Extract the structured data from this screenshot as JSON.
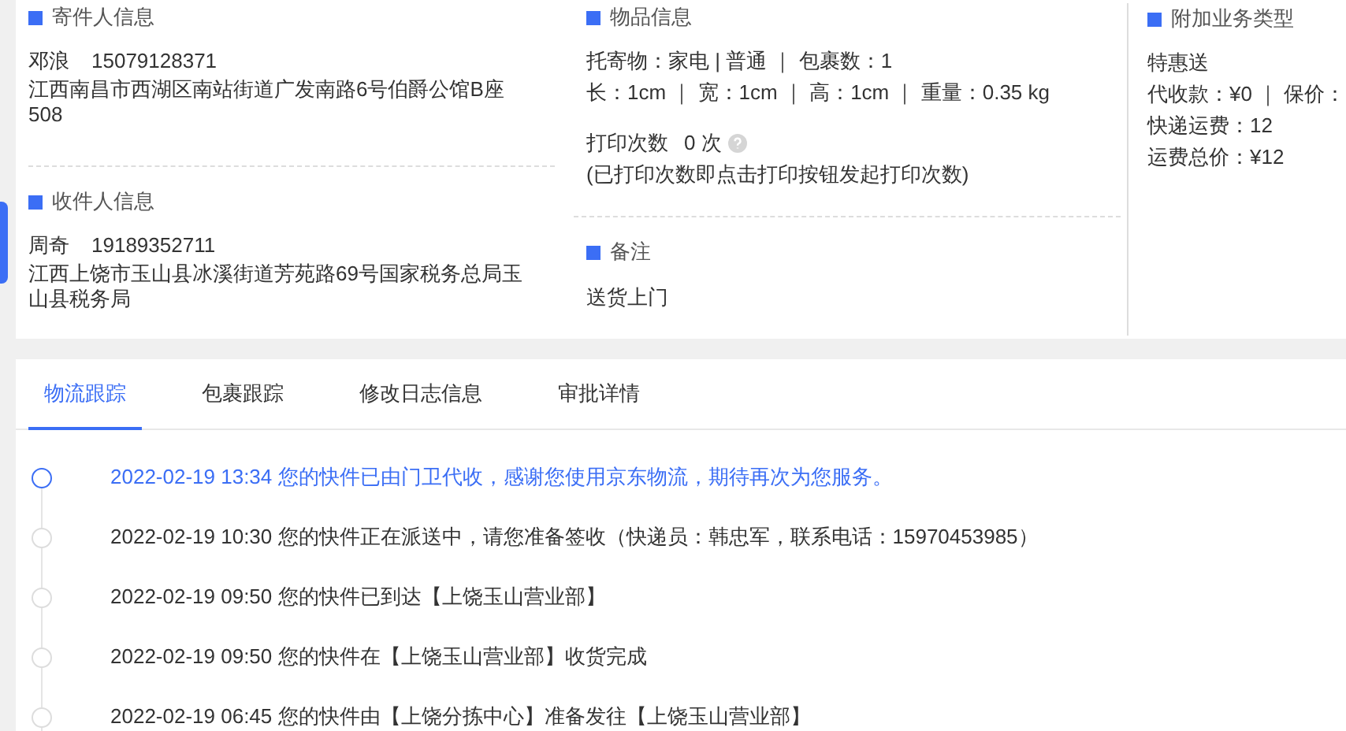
{
  "sender": {
    "title": "寄件人信息",
    "name": "邓浪",
    "phone": "15079128371",
    "address": "江西南昌市西湖区南站街道广发南路6号伯爵公馆B座508"
  },
  "recipient": {
    "title": "收件人信息",
    "name": "周奇",
    "phone": "19189352711",
    "address": "江西上饶市玉山县冰溪街道芳苑路69号国家税务总局玉山县税务局"
  },
  "goods": {
    "title": "物品信息",
    "lines": [
      "托寄物：家电 | 普通 ｜ 包裹数：1",
      "长：1cm ｜ 宽：1cm ｜ 高：1cm ｜ 重量：0.35 kg"
    ],
    "print_label": "打印次数",
    "print_value": "0 次",
    "print_note": "(已打印次数即点击打印按钮发起打印次数)"
  },
  "remark": {
    "title": "备注",
    "text": "送货上门"
  },
  "extra": {
    "title": "附加业务类型",
    "service": "特惠送",
    "lines": [
      "代收款：¥0 ｜ 保价：",
      "快递运费：12",
      "运费总价：¥12"
    ]
  },
  "tabs": [
    {
      "label": "物流跟踪",
      "selected": true
    },
    {
      "label": "包裹跟踪",
      "selected": false
    },
    {
      "label": "修改日志信息",
      "selected": false
    },
    {
      "label": "审批详情",
      "selected": false
    }
  ],
  "timeline": [
    {
      "text": "2022-02-19 13:34 您的快件已由门卫代收，感谢您使用京东物流，期待再次为您服务。",
      "active": true
    },
    {
      "text": "2022-02-19 10:30 您的快件正在派送中，请您准备签收（快递员：韩忠军，联系电话：15970453985）",
      "active": false
    },
    {
      "text": "2022-02-19 09:50 您的快件已到达【上饶玉山营业部】",
      "active": false
    },
    {
      "text": "2022-02-19 09:50 您的快件在【上饶玉山营业部】收货完成",
      "active": false
    },
    {
      "text": "2022-02-19 06:45 您的快件由【上饶分拣中心】准备发往【上饶玉山营业部】",
      "active": false
    }
  ]
}
